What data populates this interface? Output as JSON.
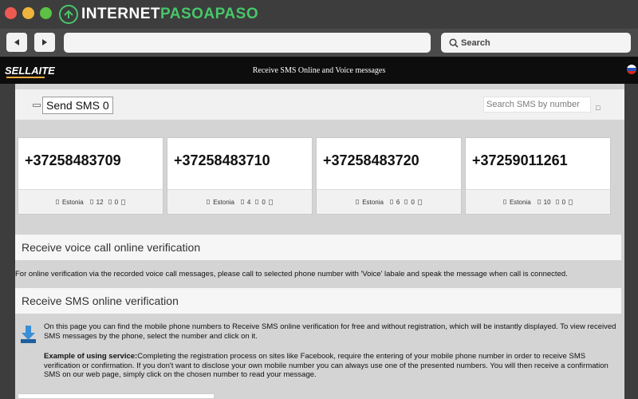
{
  "browser": {
    "brand_white": "INTERNET",
    "brand_green": "PASOAPASO",
    "search_label": "Search"
  },
  "site": {
    "logo": "SELLAITE",
    "title": "Receive SMS Online and Voice messages"
  },
  "topbar": {
    "send_sms": "Send SMS 0",
    "search_placeholder": "Search SMS by number"
  },
  "numbers": [
    {
      "number": "+37258483709",
      "country": "Estonia",
      "sms_count": "12",
      "calls": "0"
    },
    {
      "number": "+37258483710",
      "country": "Estonia",
      "sms_count": "4",
      "calls": "0"
    },
    {
      "number": "+37258483720",
      "country": "Estonia",
      "sms_count": "6",
      "calls": "0"
    },
    {
      "number": "+37259011261",
      "country": "Estonia",
      "sms_count": "10",
      "calls": "0"
    }
  ],
  "voice": {
    "heading": "Receive voice call online verification",
    "description": "For online verification via the recorded voice call messages, please call to selected phone number with 'Voice' labale and speak the message when call is connected."
  },
  "sms": {
    "heading": "Receive SMS online verification",
    "para1": "On this page you can find the mobile phone numbers to Receive SMS online verification for free and without registration, which will be instantly displayed. To view received SMS messages by the phone, select the number and click on it.",
    "example_label": "Example of using service:",
    "example_text": "Completing the registration process on sites like Facebook, require the entering of your mobile phone number in order to receive SMS verification or confirmation. If you don't want to disclose your own mobile number you can always use one of the presented numbers. You will then receive a confirmation SMS on our web page, simply click on the chosen number to read your message."
  },
  "colors": {
    "brand_green": "#47c76a",
    "header_bg": "#0d0d0d",
    "logo_accent": "#f2a93b"
  }
}
